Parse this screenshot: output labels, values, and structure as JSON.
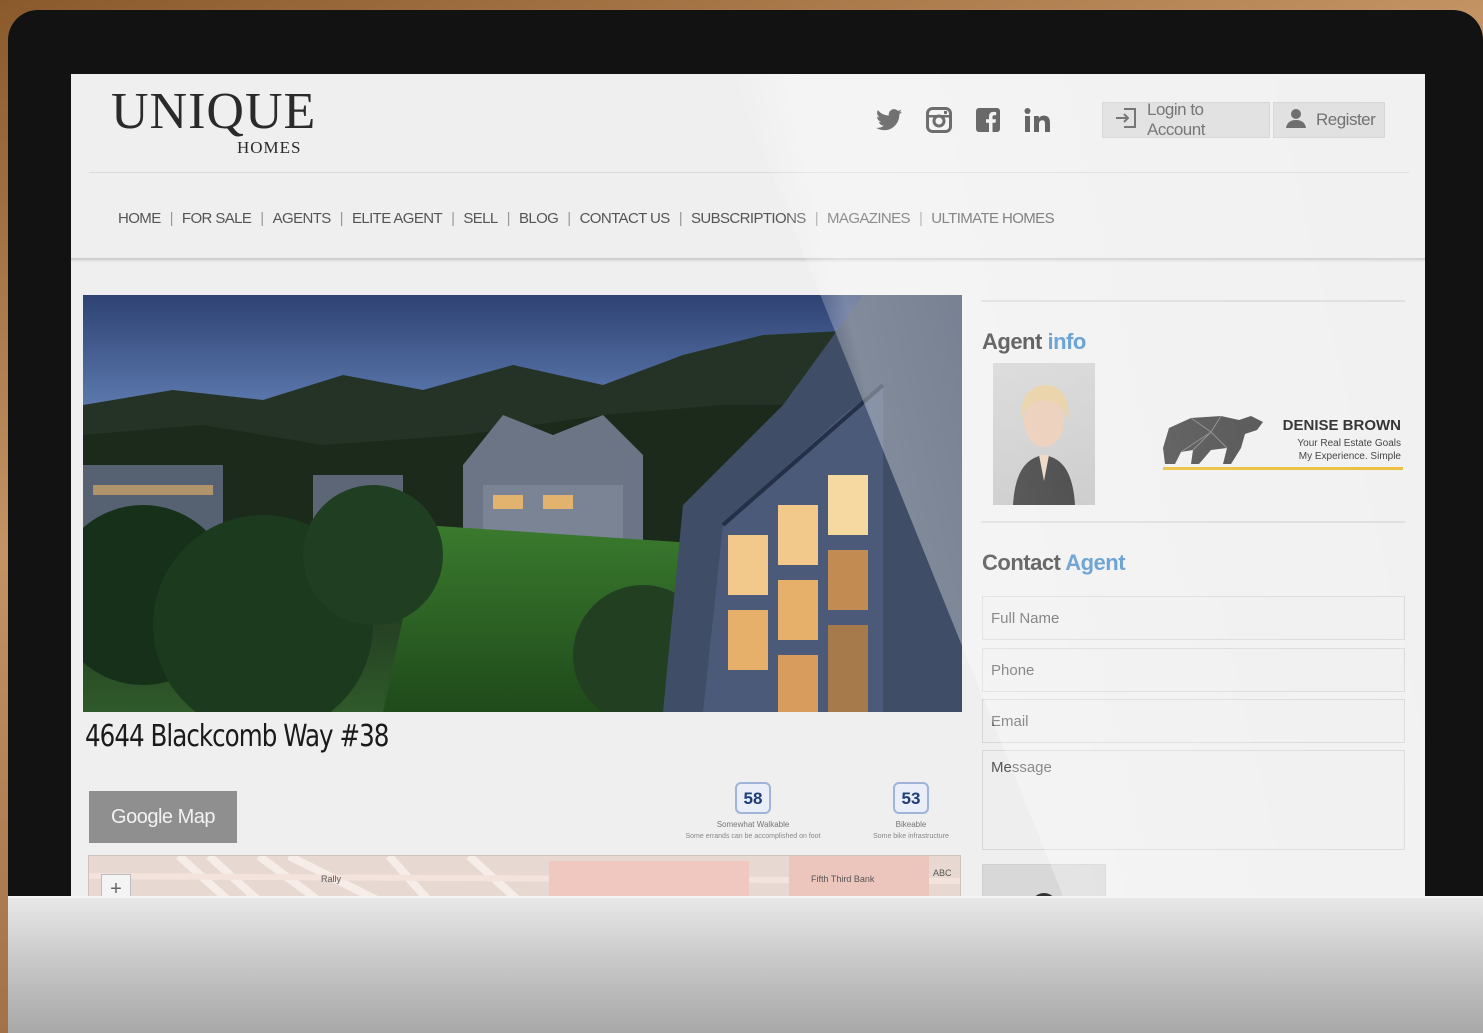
{
  "header": {
    "logo_main": "UNIQUE",
    "logo_sub": "HOMES",
    "social_icons": [
      "twitter-icon",
      "instagram-icon",
      "facebook-icon",
      "linkedin-icon"
    ],
    "login_label": "Login to Account",
    "register_label": "Register"
  },
  "nav": {
    "items": [
      "HOME",
      "FOR SALE",
      "AGENTS",
      "ELITE AGENT",
      "SELL",
      "BLOG",
      "CONTACT US",
      "SUBSCRIPTIONS",
      "MAGAZINES",
      "ULTIMATE HOMES"
    ]
  },
  "listing": {
    "address": "4644 Blackcomb Way #38",
    "map_button": "Google Map",
    "walk_score": {
      "value": "58",
      "label": "Somewhat Walkable",
      "detail": "Some errands can be accomplished on foot"
    },
    "bike_score": {
      "value": "53",
      "label": "Bikeable",
      "detail": "Some bike infrastructure"
    },
    "map_labels": [
      "Rally",
      "Fifth Third Bank",
      "ABC"
    ],
    "zoom_in": "+"
  },
  "sidebar": {
    "agent_title": "Agent",
    "agent_title_accent": "info",
    "brand_name": "DENISE BROWN",
    "brand_tag1": "Your Real Estate Goals",
    "brand_tag2": "My Experience. Simple",
    "contact_title": "Contact",
    "contact_title_accent": "Agent",
    "fields": {
      "full_name": "Full Name",
      "phone": "Phone",
      "email": "Email",
      "message": "Message"
    }
  },
  "colors": {
    "accent": "#3d86c6",
    "brand_line": "#e6b620"
  }
}
